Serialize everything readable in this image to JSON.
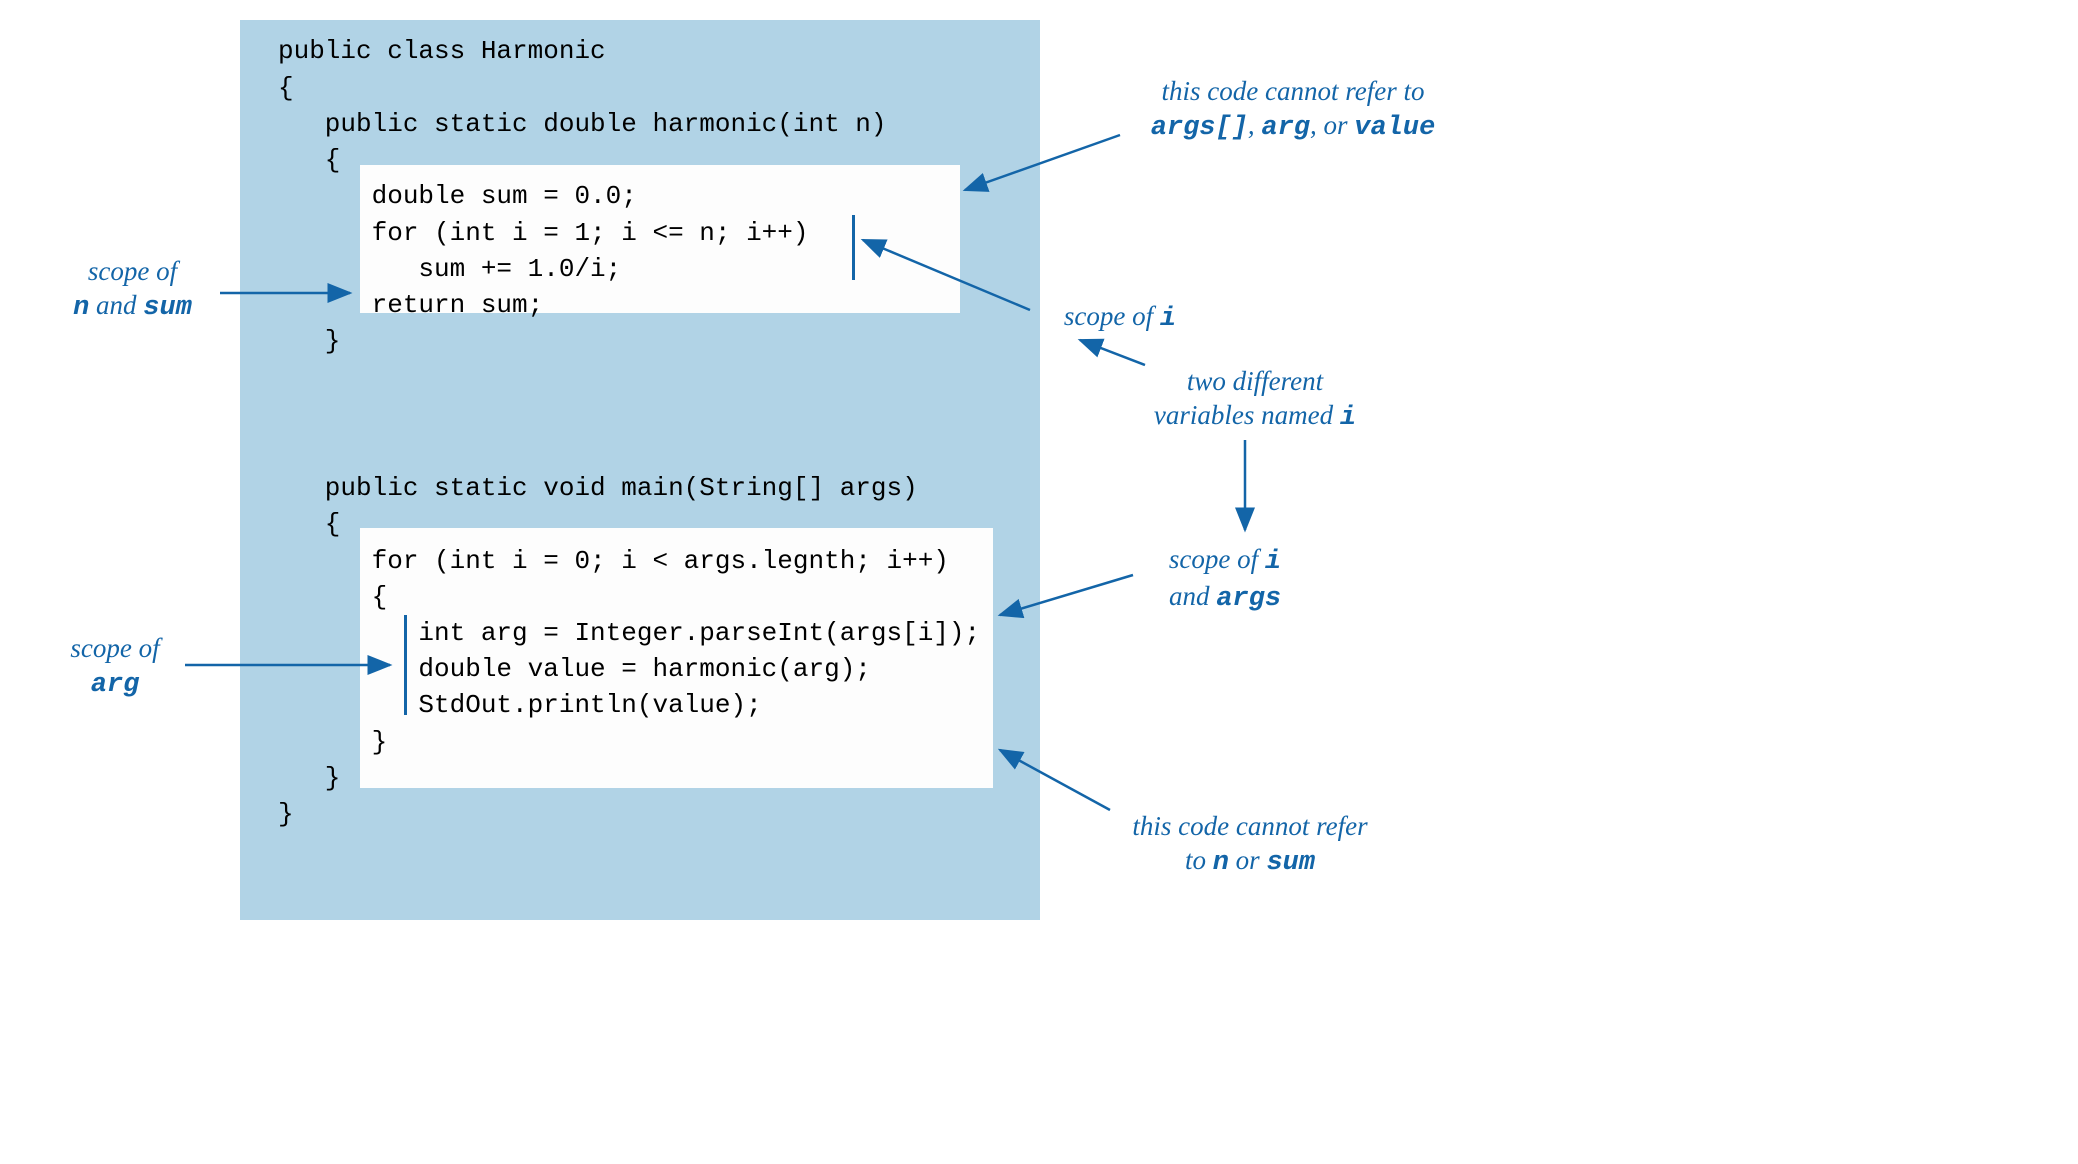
{
  "code": {
    "line1": "public class Harmonic",
    "line2": "{",
    "line3": "   public static double harmonic(int n)",
    "line4": "   {",
    "line5": "      double sum = 0.0;",
    "line6": "      for (int i = 1; i <= n; i++)",
    "line7": "         sum += 1.0/i;",
    "line8": "      return sum;",
    "line9": "   }",
    "line10": "   public static void main(String[] args)",
    "line11": "   {",
    "line12": "      for (int i = 0; i < args.legnth; i++)",
    "line13": "      {",
    "line14": "         int arg = Integer.parseInt(args[i]);",
    "line15": "         double value = harmonic(arg);",
    "line16": "         StdOut.println(value);",
    "line17": "      }",
    "line18": "   }",
    "line19": "}"
  },
  "annotations": {
    "top_right_1": "this code cannot refer to",
    "top_right_2a": "args[]",
    "top_right_2b": ", ",
    "top_right_2c": "arg",
    "top_right_2d": ", or ",
    "top_right_2e": "value",
    "scope_i_top": "scope of ",
    "scope_i_top_var": "i",
    "two_vars_1": "two different",
    "two_vars_2": "variables named ",
    "two_vars_2_var": "i",
    "scope_i_args_1": "scope of ",
    "scope_i_args_1_var": "i",
    "scope_i_args_2": "and ",
    "scope_i_args_2_var": "args",
    "bottom_right_1": "this code cannot refer",
    "bottom_right_2a": "to ",
    "bottom_right_2b": "n",
    "bottom_right_2c": " or ",
    "bottom_right_2d": "sum",
    "left_top_1": "scope of",
    "left_top_2a": "n",
    "left_top_2b": " and ",
    "left_top_2c": "sum",
    "left_bottom_1": "scope of",
    "left_bottom_2": "arg"
  }
}
